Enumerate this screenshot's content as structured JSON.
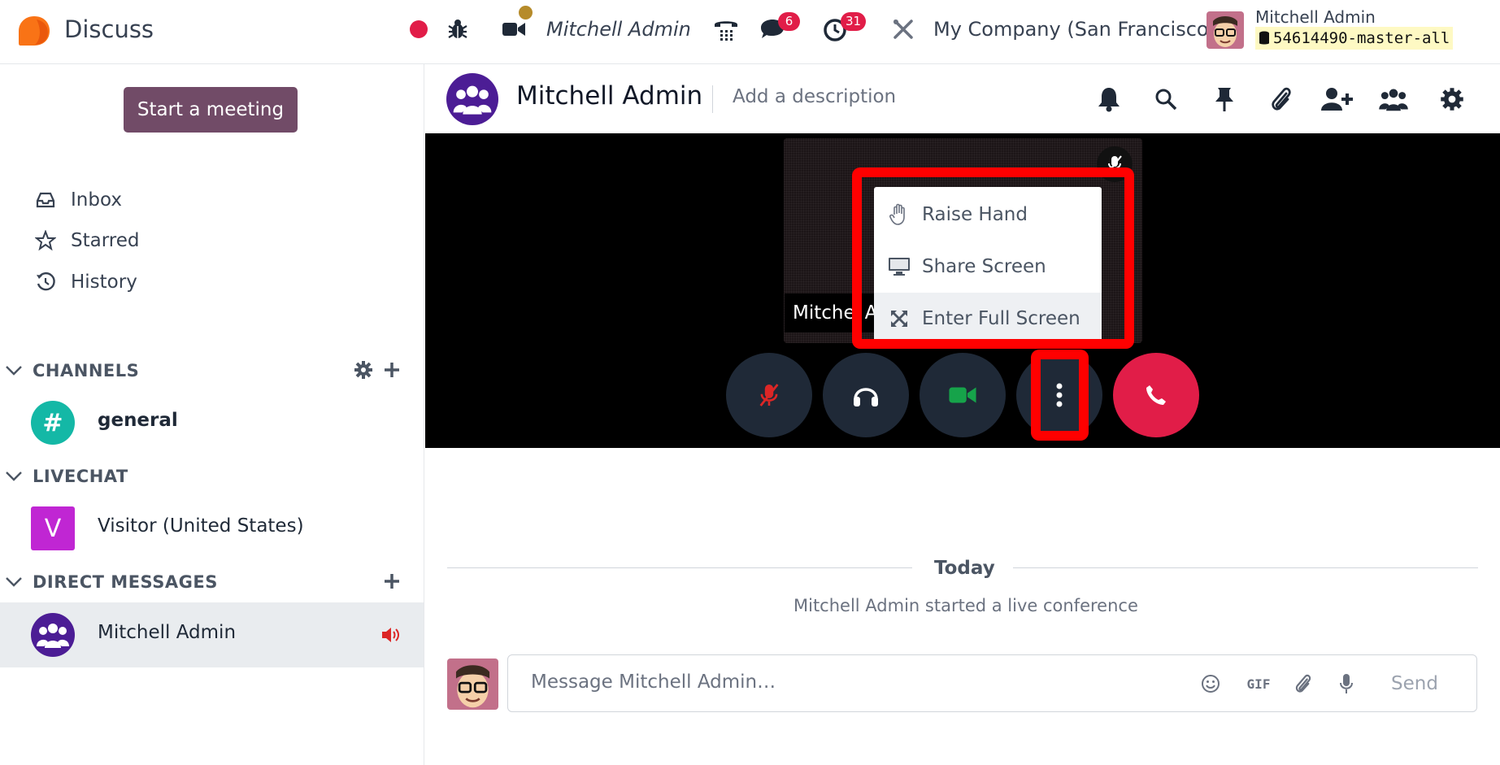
{
  "navbar": {
    "app_name": "Discuss",
    "user_label": "Mitchell Admin",
    "messages_badge": "6",
    "activities_badge": "31",
    "company": "My Company (San Francisco)",
    "user_name": "Mitchell Admin",
    "database": "54614490-master-all",
    "colors": {
      "record": "#e11d48",
      "presence": "#b68b2a",
      "badge": "#e11d48"
    }
  },
  "sidebar": {
    "start_meeting": "Start a meeting",
    "links": [
      {
        "label": "Inbox",
        "icon": "inbox-icon"
      },
      {
        "label": "Starred",
        "icon": "star-icon"
      },
      {
        "label": "History",
        "icon": "history-icon"
      }
    ],
    "channels_title": "CHANNELS",
    "channels": [
      {
        "name": "general",
        "avatar": "#"
      }
    ],
    "livechat_title": "LIVECHAT",
    "livechats": [
      {
        "name": "Visitor (United States)",
        "avatar": "V"
      }
    ],
    "dm_title": "DIRECT MESSAGES",
    "dms": [
      {
        "name": "Mitchell Admin"
      }
    ]
  },
  "thread": {
    "name": "Mitchell Admin",
    "description_placeholder": "Add a description"
  },
  "call": {
    "participant_name": "Mitche",
    "participant_name_tail": "A",
    "menu": [
      {
        "label": "Raise Hand",
        "icon": "hand-icon"
      },
      {
        "label": "Share Screen",
        "icon": "monitor-icon"
      },
      {
        "label": "Enter Full Screen",
        "icon": "expand-icon"
      }
    ]
  },
  "messages": {
    "date_separator": "Today",
    "notification": "Mitchell Admin started a live conference"
  },
  "composer": {
    "placeholder": "Message Mitchell Admin…",
    "gif_label": "GIF",
    "send_label": "Send"
  }
}
